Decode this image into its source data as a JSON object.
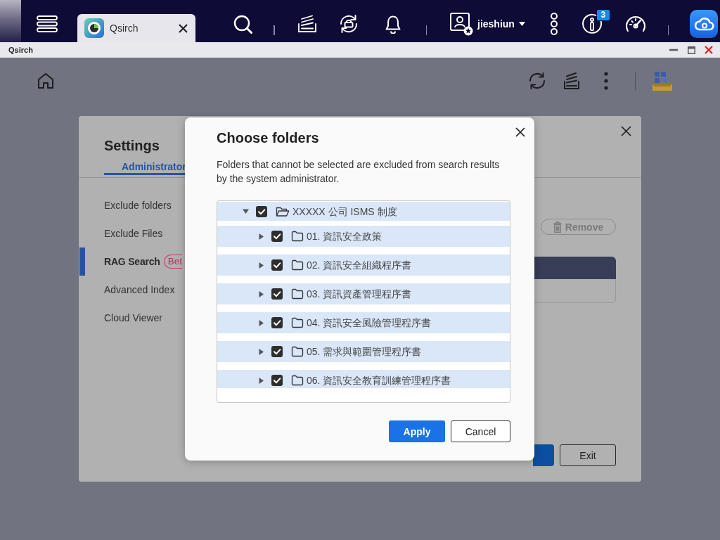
{
  "taskbar": {
    "tabs": [
      {
        "label": "Qsirch",
        "selected": true
      }
    ],
    "user": "jieshiun",
    "badge": "3"
  },
  "window": {
    "title": "Qsirch"
  },
  "settings": {
    "title": "Settings",
    "tabs": [
      {
        "label": "Administrator",
        "selected": true
      }
    ],
    "nav": [
      {
        "label": "Exclude folders",
        "selected": false
      },
      {
        "label": "Exclude Files",
        "selected": false
      },
      {
        "label": "RAG Search",
        "selected": true,
        "tag": "Bet"
      },
      {
        "label": "Advanced Index",
        "selected": false
      },
      {
        "label": "Cloud Viewer",
        "selected": false
      }
    ],
    "remove_button": {
      "label": "Remove",
      "disabled": true
    },
    "buttons": [
      {
        "kind": "primary"
      },
      {
        "label": "Exit",
        "kind": "secondary"
      }
    ]
  },
  "dialog": {
    "title": "Choose folders",
    "description": "Folders that cannot be selected are excluded from search results by the system administrator.",
    "tree": [
      {
        "label": "XXXXX 公司 ISMS 制度",
        "checked": true,
        "expanded": true,
        "children": [
          {
            "label": "01. 資訊安全政策",
            "checked": true,
            "expanded": false
          },
          {
            "label": "02. 資訊安全組織程序書",
            "checked": true,
            "expanded": false
          },
          {
            "label": "03. 資訊資產管理程序書",
            "checked": true,
            "expanded": false
          },
          {
            "label": "04. 資訊安全風險管理程序書",
            "checked": true,
            "expanded": false
          },
          {
            "label": "05. 需求與範圍管理程序書",
            "checked": true,
            "expanded": false
          },
          {
            "label": "06. 資訊安全教育訓練管理程序書",
            "checked": true,
            "expanded": false
          }
        ]
      }
    ],
    "buttons": [
      {
        "label": "Apply",
        "kind": "primary"
      },
      {
        "label": "Cancel",
        "kind": "secondary"
      }
    ]
  }
}
